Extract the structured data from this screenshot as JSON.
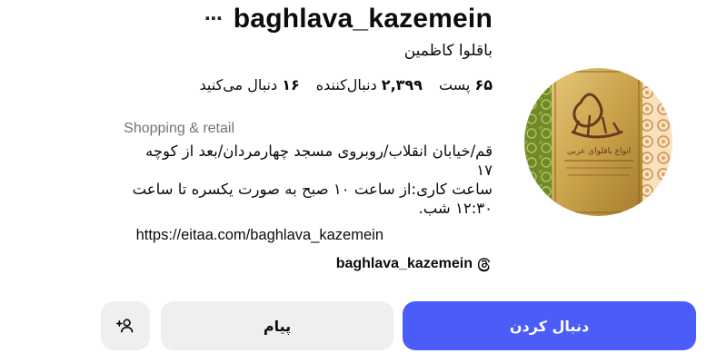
{
  "profile": {
    "username": "baghlava_kazemein",
    "more_icon": "more-horizontal-icon",
    "full_name": "باقلوا کاظمین",
    "stats": {
      "posts_value": "۶۵",
      "posts_label": "پست",
      "followers_value": "۲,۳۹۹",
      "followers_label": "دنبال‌کننده",
      "following_value": "۱۶",
      "following_label": "دنبال می‌کنید"
    },
    "category": "Shopping & retail",
    "bio": {
      "line1": "قم/خیابان انقلاب/روبروی مسجد چهارمردان/بعد از کوچه",
      "line2": "۱۷",
      "line3": "ساعت کاری:از ساعت ۱۰ صبح به صورت یکسره تا ساعت",
      "line4": "۱۲:۳۰ شب.",
      "link": "https://eitaa.com/baghlava_kazemein"
    },
    "threads": {
      "handle": "baghlava_kazemein",
      "icon": "threads-icon"
    },
    "avatar": {
      "logo_text": "الکاظمین",
      "sub_text": "انواع باقلوای عربی"
    }
  },
  "actions": {
    "follow_label": "دنبال کردن",
    "message_label": "پیام",
    "add_person_icon": "add-person-icon"
  },
  "colors": {
    "follow_button": "#4a5df9",
    "secondary_button": "#efefef",
    "category_text": "#737373",
    "avatar_gold": "#c9a24a",
    "avatar_brown": "#6b3a1e"
  }
}
